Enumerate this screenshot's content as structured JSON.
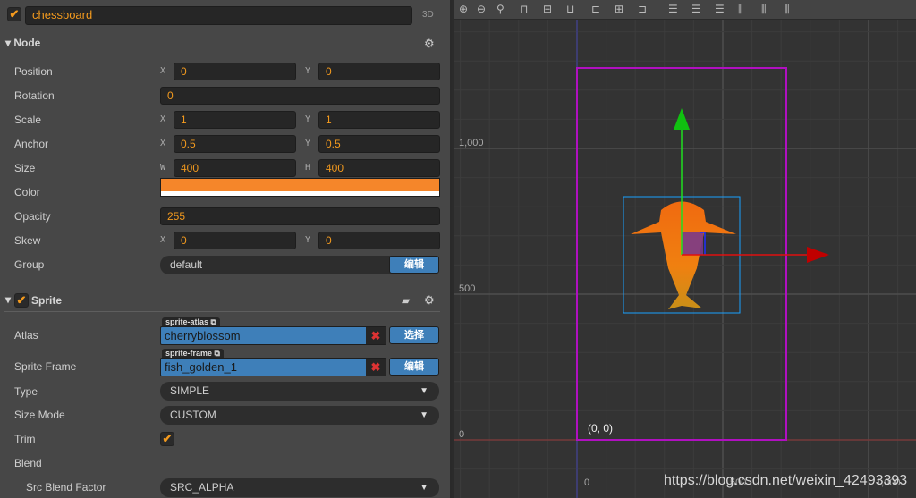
{
  "node_name": "chessboard",
  "mode_3d": "3D",
  "node": {
    "title": "Node",
    "rows": [
      {
        "label": "Position",
        "type": "xy",
        "a": "X",
        "av": "0",
        "b": "Y",
        "bv": "0"
      },
      {
        "label": "Rotation",
        "type": "single",
        "v": "0"
      },
      {
        "label": "Scale",
        "type": "xy",
        "a": "X",
        "av": "1",
        "b": "Y",
        "bv": "1"
      },
      {
        "label": "Anchor",
        "type": "xy",
        "a": "X",
        "av": "0.5",
        "b": "Y",
        "bv": "0.5"
      },
      {
        "label": "Size",
        "type": "xy",
        "a": "W",
        "av": "400",
        "b": "H",
        "bv": "400"
      },
      {
        "label": "Color",
        "type": "color",
        "color": "#f5862a"
      },
      {
        "label": "Opacity",
        "type": "single",
        "v": "255"
      },
      {
        "label": "Skew",
        "type": "xy",
        "a": "X",
        "av": "0",
        "b": "Y",
        "bv": "0"
      }
    ],
    "group_label": "Group",
    "group_value": "default",
    "group_edit": "编辑"
  },
  "sprite": {
    "title": "Sprite",
    "atlas_label": "Atlas",
    "atlas_tag": "sprite-atlas",
    "atlas_value": "cherryblossom",
    "atlas_btn": "选择",
    "frame_label": "Sprite Frame",
    "frame_tag": "sprite-frame",
    "frame_value": "fish_golden_1",
    "frame_btn": "编辑",
    "type_label": "Type",
    "type_value": "SIMPLE",
    "sizemode_label": "Size Mode",
    "sizemode_value": "CUSTOM",
    "trim_label": "Trim",
    "trim_checked": true,
    "blend_label": "Blend",
    "src_label": "Src Blend Factor",
    "src_value": "SRC_ALPHA"
  },
  "scene": {
    "y_labels": [
      "1,000",
      "500",
      "0"
    ],
    "x_labels": [
      "0",
      "500",
      "1,000"
    ],
    "origin_label": "(0,  0)",
    "watermark": "https://blog.csdn.net/weixin_42493393"
  }
}
